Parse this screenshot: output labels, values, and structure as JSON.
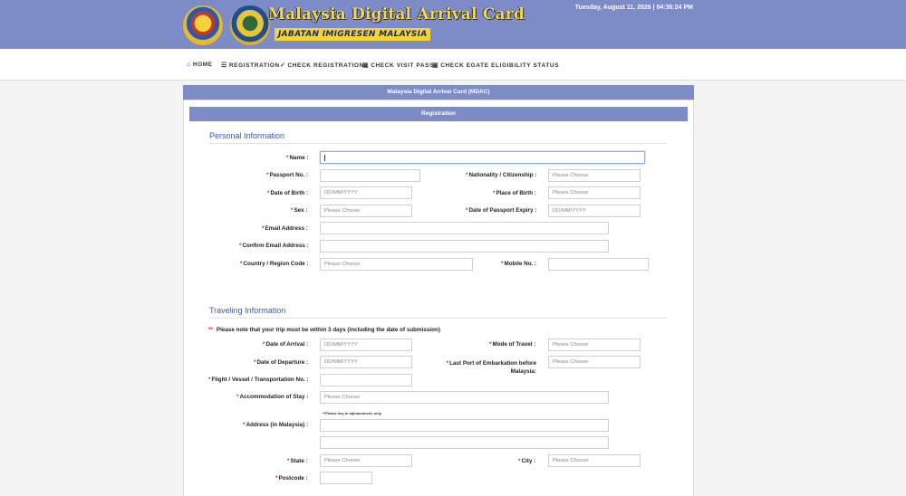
{
  "header": {
    "title": "Malaysia Digital Arrival Card",
    "subtitle": "JABATAN IMIGRESEN MALAYSIA",
    "datetime": "Tuesday, August 11, 2026 | 04:36:24 PM"
  },
  "nav": {
    "home": "HOME",
    "registration": "REGISTRATION",
    "check_registration": "CHECK REGISTRATION",
    "check_visit_pass": "CHECK VISIT PASS",
    "check_egate": "CHECK EGATE ELIGIBILITY STATUS"
  },
  "main": {
    "bar_title": "Malaysia Digital Arrival Card (MDAC)",
    "reg_title": "Registration"
  },
  "personal": {
    "title": "Personal Information",
    "name": "Name :",
    "passport_no": "Passport No. :",
    "nationality": "Nationality / Citizenship :",
    "dob": "Date of Birth :",
    "place_of_birth": "Place of Birth :",
    "sex": "Sex :",
    "passport_expiry": "Date of Passport Expiry :",
    "email": "Email Address :",
    "confirm_email": "Confirm Email Address :",
    "country_code": "Country / Region Code :",
    "mobile": "Mobile No. :"
  },
  "travel": {
    "title": "Traveling Information",
    "note": "Please note that your trip must be within 3 days (including the date of submission)",
    "arrival": "Date of Arrival :",
    "mode": "Mode of Travel :",
    "departure": "Date of Departure :",
    "last_port": "Last Port of Embarkation before Malaysia:",
    "flight": "Flight / Vessel / Transportation No. :",
    "accommodation": "Accommodation of Stay :",
    "alnum_hint": "**Please key-in alphanumeric only",
    "address": "Address (in Malaysia) :",
    "state": "State :",
    "city": "City :",
    "postcode": "Postcode :"
  },
  "placeholders": {
    "choose": "Please Choose",
    "date": "DD/MM/YYYY"
  }
}
